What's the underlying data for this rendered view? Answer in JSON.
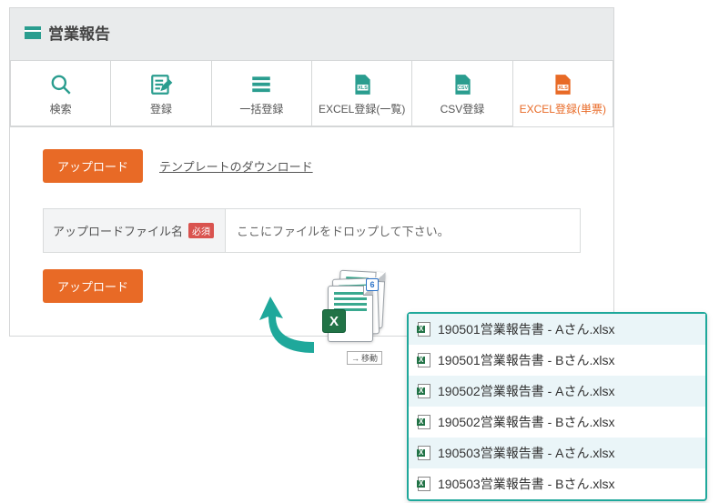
{
  "header": {
    "title": "営業報告"
  },
  "tabs": [
    {
      "label": "検索"
    },
    {
      "label": "登録"
    },
    {
      "label": "一括登録"
    },
    {
      "label": "EXCEL登録(一覧)"
    },
    {
      "label": "CSV登録"
    },
    {
      "label": "EXCEL登録(単票)"
    }
  ],
  "actions": {
    "upload": "アップロード",
    "template_dl": "テンプレートのダウンロード",
    "upload2": "アップロード"
  },
  "form": {
    "label": "アップロードファイル名",
    "required": "必須",
    "drop_hint": "ここにファイルをドロップして下さい。"
  },
  "drag": {
    "count": "6",
    "move_label": "移動"
  },
  "files": [
    "190501営業報告書 - Aさん.xlsx",
    "190501営業報告書 - Bさん.xlsx",
    "190502営業報告書 - Aさん.xlsx",
    "190502営業報告書 - Bさん.xlsx",
    "190503営業報告書 - Aさん.xlsx",
    "190503営業報告書 - Bさん.xlsx"
  ]
}
